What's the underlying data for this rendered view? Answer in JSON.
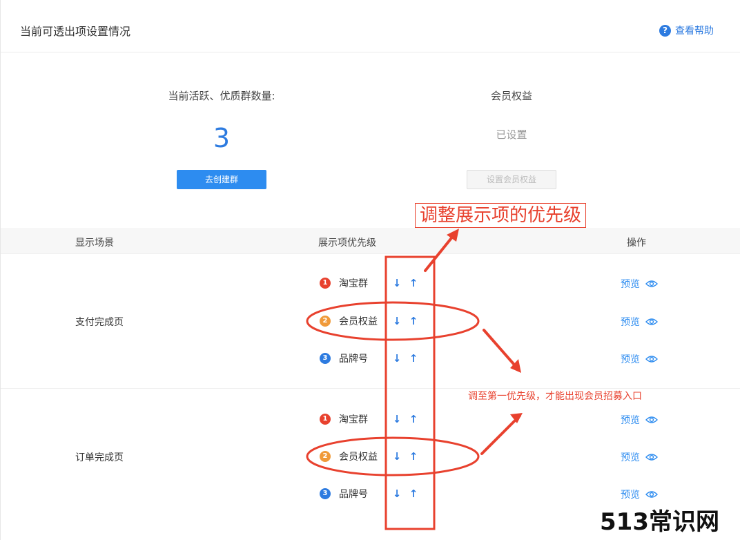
{
  "header": {
    "title": "当前可透出项设置情况",
    "help_label": "查看帮助"
  },
  "stats": {
    "active_groups": {
      "heading": "当前活跃、优质群数量:",
      "value": "3",
      "button": "去创建群"
    },
    "member_benefit": {
      "heading": "会员权益",
      "status": "已设置",
      "button": "设置会员权益"
    }
  },
  "table": {
    "columns": {
      "scene": "显示场景",
      "priority": "展示项优先级",
      "ops": "操作"
    },
    "groups": [
      {
        "scene": "支付完成页",
        "items": [
          {
            "rank": "1",
            "name": "淘宝群",
            "color": "#e8412e",
            "down": "↓",
            "up": "↑",
            "preview": "预览"
          },
          {
            "rank": "2",
            "name": "会员权益",
            "color": "#f09a3a",
            "down": "↓",
            "up": "↑",
            "preview": "预览"
          },
          {
            "rank": "3",
            "name": "品牌号",
            "color": "#2d7be0",
            "down": "↓",
            "up": "↑",
            "preview": "预览"
          }
        ]
      },
      {
        "scene": "订单完成页",
        "items": [
          {
            "rank": "1",
            "name": "淘宝群",
            "color": "#e8412e",
            "down": "↓",
            "up": "↑",
            "preview": "预览"
          },
          {
            "rank": "2",
            "name": "会员权益",
            "color": "#f09a3a",
            "down": "↓",
            "up": "↑",
            "preview": "预览"
          },
          {
            "rank": "3",
            "name": "品牌号",
            "color": "#2d7be0",
            "down": "↓",
            "up": "↑",
            "preview": "预览"
          }
        ]
      }
    ]
  },
  "annotations": {
    "callout": "调整展示项的优先级",
    "note": "调至第一优先级，才能出现会员招募入口",
    "color": "#e8412e"
  },
  "watermark": "513常识网",
  "colors": {
    "accent": "#2d7be0",
    "annotation": "#e8412e"
  }
}
